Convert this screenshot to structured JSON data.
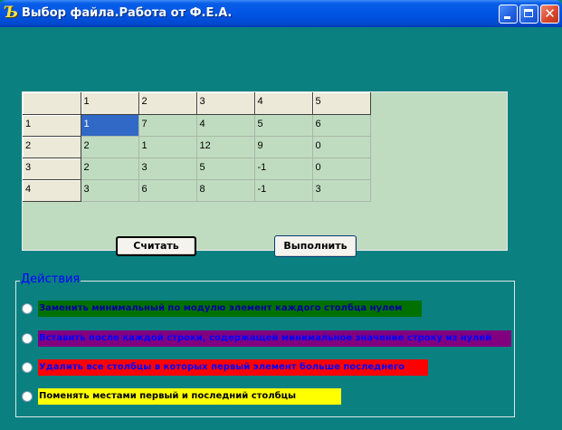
{
  "window": {
    "title": "Выбор файла.Работа от Ф.Е.А.",
    "app_icon_glyph": "Ъ"
  },
  "grid": {
    "header_row": [
      "",
      "1",
      "2",
      "3",
      "4",
      "5"
    ],
    "rows": [
      {
        "label": "1",
        "cells": [
          "1",
          "7",
          "4",
          "5",
          "6"
        ]
      },
      {
        "label": "2",
        "cells": [
          "2",
          "1",
          "12",
          "9",
          "0"
        ]
      },
      {
        "label": "3",
        "cells": [
          "2",
          "3",
          "5",
          "-1",
          "0"
        ]
      },
      {
        "label": "4",
        "cells": [
          "3",
          "6",
          "8",
          "-1",
          "3"
        ]
      }
    ],
    "selected_cell": "row1-col1"
  },
  "buttons": {
    "read_label": "Считать",
    "run_label": "Выполнить"
  },
  "actions": {
    "title": "Действия",
    "options": [
      {
        "label": "Заменить минимальный по модулю элемент каждого столбца нулем",
        "bg": "#007000",
        "fg": "#0000a0"
      },
      {
        "label": "Вставить после каждой строки, содержащей минимальное значение строку из нулей",
        "bg": "#800080",
        "fg": "#0000ff"
      },
      {
        "label": "Удалить все столбцы в которых первый элемент больше последнего",
        "bg": "#ff0000",
        "fg": "#0000ff"
      },
      {
        "label": "Поменять местами первый и последний столбцы",
        "bg": "#ffff00",
        "fg": "#000000"
      }
    ]
  },
  "colors": {
    "window_bg": "#0b8080",
    "grid_bg": "#c0dcc0",
    "selection": "#3169c6",
    "group_title": "#0000ff"
  }
}
